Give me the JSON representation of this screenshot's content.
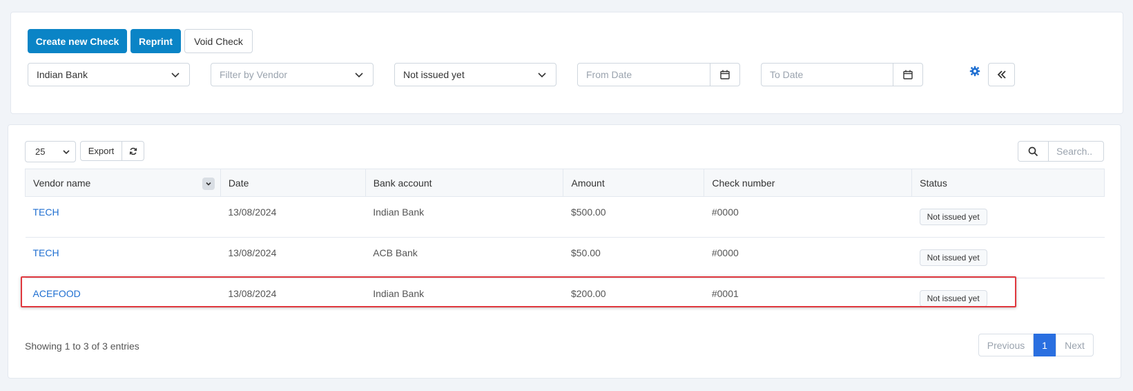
{
  "toolbar": {
    "create_label": "Create new Check",
    "reprint_label": "Reprint",
    "void_label": "Void Check"
  },
  "filters": {
    "bank": "Indian Bank",
    "vendor_placeholder": "Filter by Vendor",
    "status": "Not issued yet",
    "from_date_placeholder": "From Date",
    "to_date_placeholder": "To Date"
  },
  "table_controls": {
    "page_length": "25",
    "export_label": "Export",
    "search_placeholder": "Search.."
  },
  "table": {
    "headers": [
      "Vendor name",
      "Date",
      "Bank account",
      "Amount",
      "Check number",
      "Status"
    ],
    "rows": [
      {
        "vendor": "TECH",
        "date": "13/08/2024",
        "bank": "Indian Bank",
        "amount": "$500.00",
        "check": "#0000",
        "status": "Not issued yet"
      },
      {
        "vendor": "TECH",
        "date": "13/08/2024",
        "bank": "ACB Bank",
        "amount": "$50.00",
        "check": "#0000",
        "status": "Not issued yet"
      },
      {
        "vendor": "ACEFOOD",
        "date": "13/08/2024",
        "bank": "Indian Bank",
        "amount": "$200.00",
        "check": "#0001",
        "status": "Not issued yet"
      }
    ]
  },
  "footer": {
    "info": "Showing 1 to 3 of 3 entries",
    "previous": "Previous",
    "current_page": "1",
    "next": "Next"
  },
  "colors": {
    "primary": "#0a84c6",
    "link": "#1f6fd1",
    "highlight": "#e0383e",
    "pager_active": "#2a6fe0"
  }
}
